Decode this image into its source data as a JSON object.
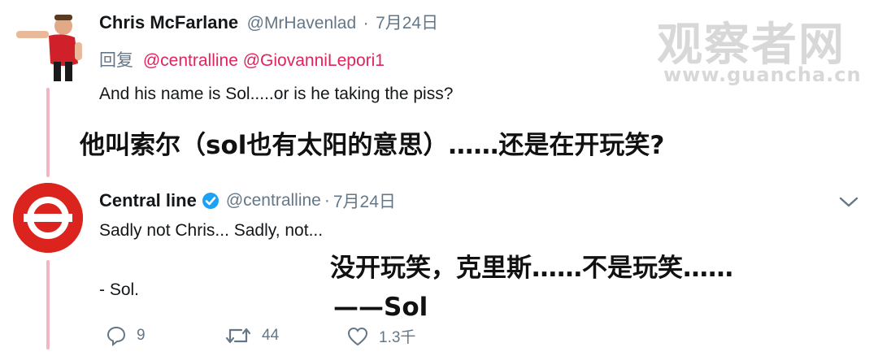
{
  "watermark": {
    "cn": "观察者网",
    "url": "www.guancha.cn"
  },
  "tweet1": {
    "name": "Chris McFarlane",
    "handle": "@MrHavenlad",
    "sep": "·",
    "date": "7月24日",
    "reply_prefix": "回复",
    "mentions": "@centralline @GiovanniLepori1",
    "text": "And his name is Sol.....or is he taking the piss?",
    "overlay_cn": "他叫索尔（sol也有太阳的意思）……还是在开玩笑?"
  },
  "tweet2": {
    "name": "Central line",
    "handle": "@centralline",
    "sep": "·",
    "date": "7月24日",
    "text_line1": "Sadly not Chris... Sadly, not...",
    "text_line2": "- Sol.",
    "overlay_cn_line1": "没开玩笑，克里斯……不是玩笑……",
    "overlay_cn_line2": "——Sol",
    "actions": {
      "replies": "9",
      "retweets": "44",
      "likes": "1.3千"
    }
  },
  "colors": {
    "tfl_red": "#dc241f",
    "mention": "#e0245e",
    "verified": "#1da1f2",
    "muted": "#657786"
  }
}
